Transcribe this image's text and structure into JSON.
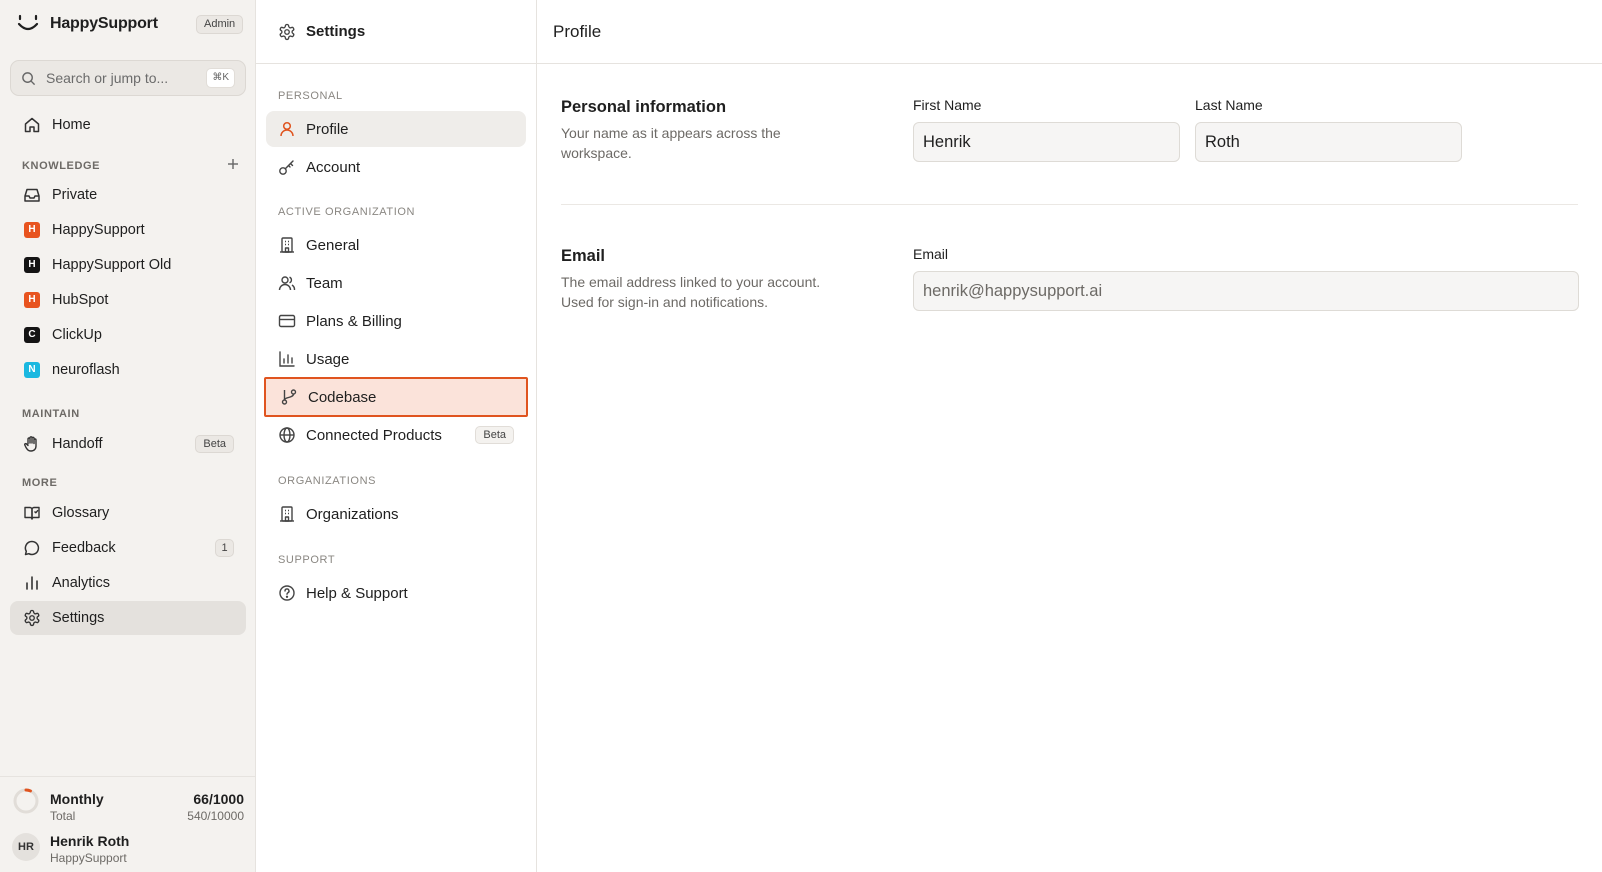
{
  "app": {
    "name": "HappySupport",
    "role_badge": "Admin"
  },
  "search": {
    "placeholder": "Search or jump to...",
    "shortcut": "⌘K"
  },
  "sidebar": {
    "home": {
      "label": "Home",
      "icon": "home-icon"
    },
    "knowledge_label": "KNOWLEDGE",
    "knowledge_items": [
      {
        "label": "Private",
        "icon": "inbox-icon"
      },
      {
        "label": "HappySupport",
        "letter": "H",
        "color": "#e8541f"
      },
      {
        "label": "HappySupport Old",
        "letter": "H",
        "color": "#141414"
      },
      {
        "label": "HubSpot",
        "letter": "H",
        "color": "#e8541f"
      },
      {
        "label": "ClickUp",
        "letter": "C",
        "color": "#141414"
      },
      {
        "label": "neuroflash",
        "letter": "N",
        "color": "#1ab8e0"
      }
    ],
    "maintain_label": "MAINTAIN",
    "handoff": {
      "label": "Handoff",
      "tag": "Beta",
      "icon": "hand-icon"
    },
    "more_label": "MORE",
    "more_items": [
      {
        "label": "Glossary",
        "icon": "book-icon"
      },
      {
        "label": "Feedback",
        "icon": "chat-bubble-icon",
        "count": "1"
      },
      {
        "label": "Analytics",
        "icon": "bar-chart-icon"
      },
      {
        "label": "Settings",
        "icon": "gear-icon",
        "active": true
      }
    ]
  },
  "usage": {
    "title": "Monthly",
    "subtitle": "Total",
    "value": "66/1000",
    "total": "540/10000",
    "fraction": 0.066
  },
  "user": {
    "initials": "HR",
    "name": "Henrik Roth",
    "org": "HappySupport"
  },
  "settings_panel": {
    "title": "Settings",
    "sections": {
      "personal": "PERSONAL",
      "active_org": "ACTIVE ORGANIZATION",
      "organizations": "ORGANIZATIONS",
      "support": "SUPPORT"
    },
    "items": {
      "profile": "Profile",
      "account": "Account",
      "general": "General",
      "team": "Team",
      "billing": "Plans & Billing",
      "usage": "Usage",
      "codebase": "Codebase",
      "connected": "Connected Products",
      "connected_tag": "Beta",
      "organizations": "Organizations",
      "help": "Help & Support"
    }
  },
  "main": {
    "title": "Profile",
    "personal": {
      "title": "Personal information",
      "description": "Your name as it appears across the workspace.",
      "first_name_label": "First Name",
      "first_name_value": "Henrik",
      "last_name_label": "Last Name",
      "last_name_value": "Roth"
    },
    "email": {
      "title": "Email",
      "description": "The email address linked to your account. Used for sign-in and notifications.",
      "label": "Email",
      "value": "henrik@happysupport.ai"
    }
  },
  "colors": {
    "accent": "#e0541f",
    "highlight_bg": "#fbe3da",
    "sidebar_bg": "#f4f2ef"
  }
}
